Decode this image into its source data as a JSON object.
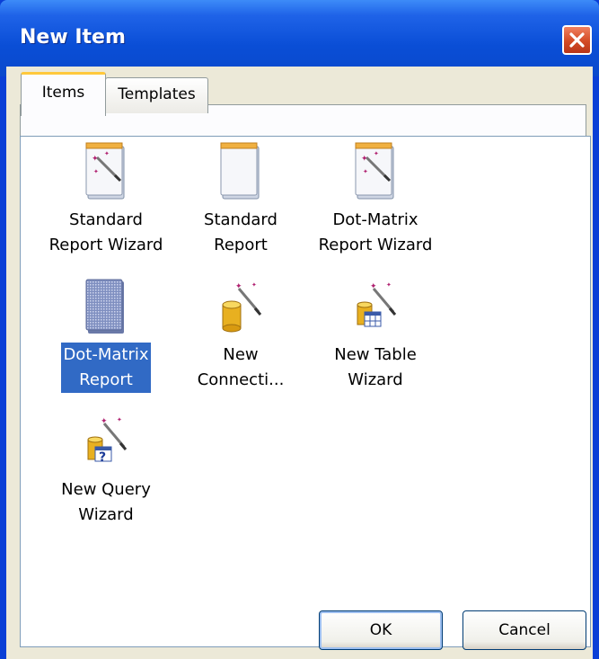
{
  "window": {
    "title": "New Item",
    "close_icon": "close-icon"
  },
  "tabs": [
    {
      "label": "Items",
      "selected": true
    },
    {
      "label": "Templates",
      "selected": false
    }
  ],
  "items": [
    {
      "label": "Standard\nReport Wizard",
      "icon": "report-wizard-icon",
      "selected": false
    },
    {
      "label": "Standard\nReport",
      "icon": "report-icon",
      "selected": false
    },
    {
      "label": "Dot-Matrix\nReport Wizard",
      "icon": "report-wizard-icon",
      "selected": false
    },
    {
      "label": "Dot-Matrix\nReport",
      "icon": "dot-matrix-report-icon",
      "selected": true
    },
    {
      "label": "New\nConnecti...",
      "icon": "connection-wizard-icon",
      "selected": false
    },
    {
      "label": "New Table\nWizard",
      "icon": "table-wizard-icon",
      "selected": false
    },
    {
      "label": "New Query\nWizard",
      "icon": "query-wizard-icon",
      "selected": false
    }
  ],
  "buttons": {
    "ok": "OK",
    "cancel": "Cancel"
  },
  "colors": {
    "title_bar": "#0a4ed6",
    "selection": "#316ac5",
    "dialog_bg": "#ece9d8",
    "tab_accent": "#ffc83c"
  }
}
